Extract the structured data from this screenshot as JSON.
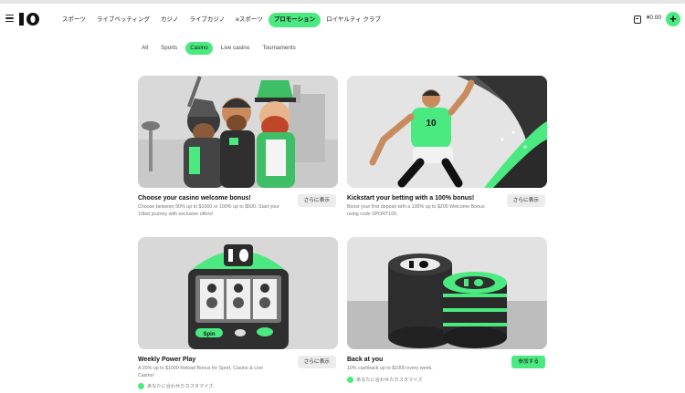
{
  "nav": {
    "items": [
      "スポーツ",
      "ライブベッティング",
      "カジノ",
      "ライブカジノ",
      "eスポーツ",
      "プロモーション",
      "ロイヤルティ クラブ"
    ],
    "active_index": 5,
    "balance": "¥0.00"
  },
  "filters": {
    "items": [
      "All",
      "Sports",
      "Casino",
      "Live casino",
      "Tournaments"
    ],
    "active_index": 2
  },
  "cards": [
    {
      "title": "Choose your casino welcome bonus!",
      "desc": "Choose between 50% up to $1000 or 100% up to $500. Start your 10bet journey with exclusive offers!",
      "button": "さらに表示"
    },
    {
      "title": "Kickstart your betting with a 100% bonus!",
      "desc": "Boost your first deposit with a 100% up to $200 Welcome Bonus using code SPORT100.",
      "button": "さらに表示",
      "badge": "10"
    },
    {
      "title": "Weekly Power Play",
      "desc": "A 20% up to $1000 Reload Bonus for Sport, Casino & Live Casino!",
      "button": "さらに表示",
      "tag": "あなたに合わせたカスタマイズ",
      "machine_label": "Spin"
    },
    {
      "title": "Back at you",
      "desc": "10% cashback up to $1000 every week.",
      "button": "参加する",
      "tag": "あなたに合わせたカスタマイズ"
    }
  ],
  "colors": {
    "accent": "#4bea80"
  }
}
